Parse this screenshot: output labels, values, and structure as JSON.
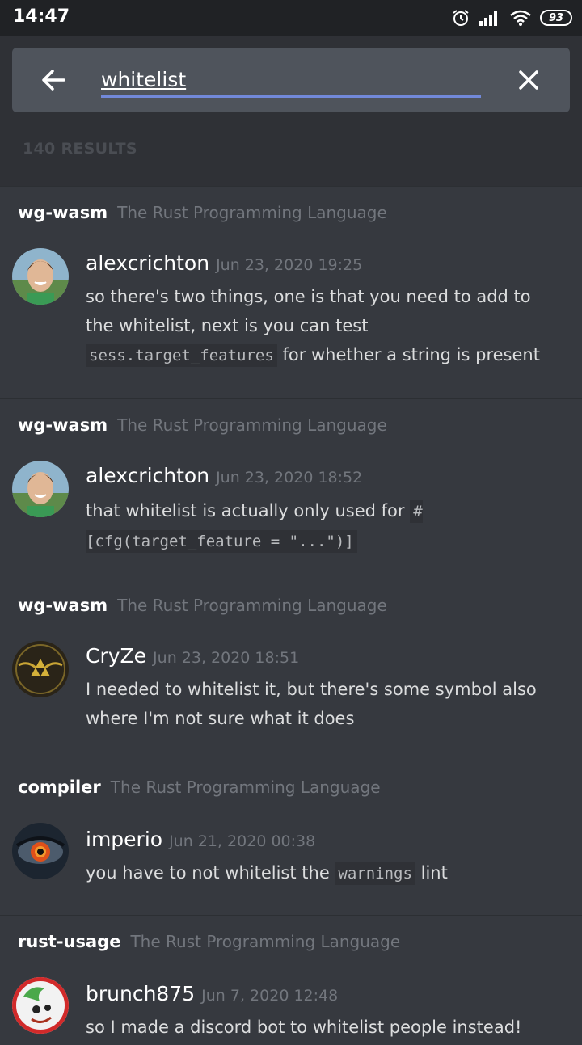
{
  "status_bar": {
    "time": "14:47",
    "battery": "93",
    "icons": [
      "alarm-icon",
      "signal-icon",
      "wifi-icon",
      "battery-icon"
    ]
  },
  "search": {
    "query": "whitelist",
    "back_icon": "arrow-left-icon",
    "clear_icon": "close-icon"
  },
  "results_count": "140 RESULTS",
  "colors": {
    "background": "#36393f",
    "header": "#2f3136",
    "status_bar": "#202225",
    "accent": "#7289da"
  },
  "results": [
    {
      "channel": "wg-wasm",
      "guild": "The Rust Programming Language",
      "author": "alexcrichton",
      "timestamp": "Jun 23, 2020 19:25",
      "text_1": "so there's two things, one is that you need to add to the whitelist, next is you can test ",
      "code_1": "sess.target_features",
      "text_2": " for whether a string is present"
    },
    {
      "channel": "wg-wasm",
      "guild": "The Rust Programming Language",
      "author": "alexcrichton",
      "timestamp": "Jun 23, 2020 18:52",
      "text_1": "that whitelist is actually only used for ",
      "code_1": "#[cfg(target_feature = \"...\")]",
      "text_2": ""
    },
    {
      "channel": "wg-wasm",
      "guild": "The Rust Programming Language",
      "author": "CryZe",
      "timestamp": "Jun 23, 2020 18:51",
      "text_1": "I needed to whitelist it, but there's some symbol also where I'm not sure what it does",
      "code_1": "",
      "text_2": ""
    },
    {
      "channel": "compiler",
      "guild": "The Rust Programming Language",
      "author": "imperio",
      "timestamp": "Jun 21, 2020 00:38",
      "text_1": "you have to not whitelist the ",
      "code_1": "warnings",
      "text_2": " lint"
    },
    {
      "channel": "rust-usage",
      "guild": "The Rust Programming Language",
      "author": "brunch875",
      "timestamp": "Jun 7, 2020 12:48",
      "text_1": "so I made a discord bot to whitelist people instead!",
      "code_1": "",
      "text_2": ""
    }
  ]
}
